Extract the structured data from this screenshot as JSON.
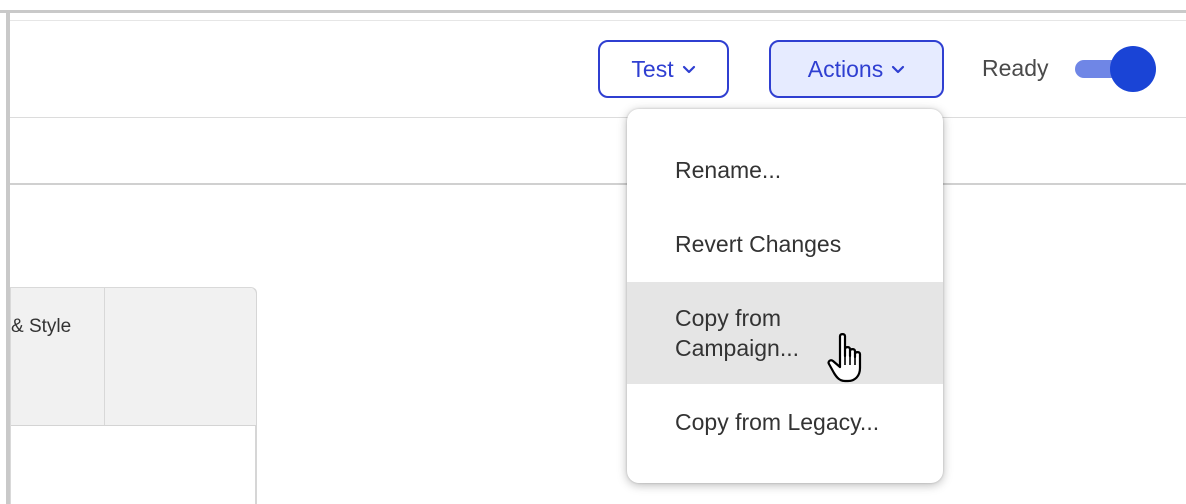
{
  "header": {
    "test_button": {
      "label": "Test",
      "icon": "chevron-down-icon"
    },
    "actions_button": {
      "label": "Actions",
      "icon": "chevron-down-icon"
    },
    "status": {
      "label": "Ready",
      "toggle_on": true
    }
  },
  "actions_menu": {
    "items": [
      {
        "label": "Rename..."
      },
      {
        "label": "Revert Changes"
      },
      {
        "label": "Copy from Campaign...",
        "hovered": true
      },
      {
        "label": "Copy from Legacy..."
      }
    ]
  },
  "card": {
    "header_label": "& Style"
  },
  "colors": {
    "accent": "#2f3fd1",
    "button_active_bg": "#e6ebff",
    "toggle_knob": "#1a44d6",
    "toggle_track": "#6f86e6",
    "menu_hover_bg": "#e5e5e5"
  },
  "cursor": {
    "icon": "hand-pointer-icon"
  }
}
